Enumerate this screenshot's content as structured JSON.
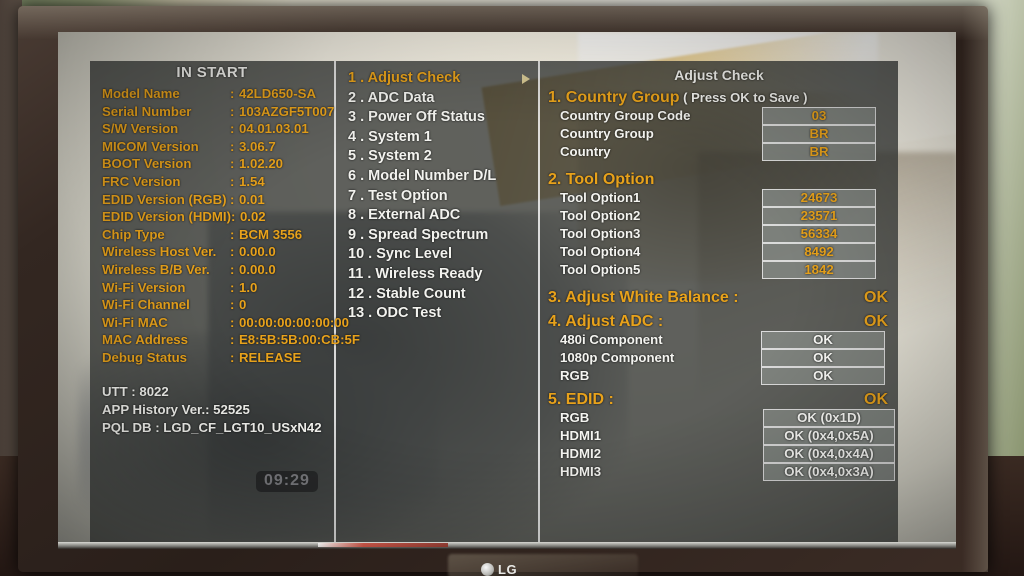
{
  "device": {
    "brand": "LG",
    "clock": "09:29"
  },
  "left_panel": {
    "title": "IN START",
    "info": [
      {
        "key": "Model Name",
        "sep": ":",
        "value": "42LD650-SA"
      },
      {
        "key": "Serial Number",
        "sep": ":",
        "value": "103AZGF5T007"
      },
      {
        "key": "S/W Version",
        "sep": ":",
        "value": "04.01.03.01"
      },
      {
        "key": "MICOM Version",
        "sep": ":",
        "value": "3.06.7"
      },
      {
        "key": "BOOT Version",
        "sep": ":",
        "value": "1.02.20"
      },
      {
        "key": "FRC Version",
        "sep": ":",
        "value": "1.54"
      },
      {
        "key": "EDID Version (RGB)",
        "sep": ":",
        "value": "0.01"
      },
      {
        "key": "EDID Version (HDMI)",
        "sep": ":",
        "value": "0.02"
      },
      {
        "key": "Chip Type",
        "sep": ":",
        "value": "BCM 3556"
      },
      {
        "key": "Wireless Host Ver.",
        "sep": ":",
        "value": "0.00.0"
      },
      {
        "key": "Wireless B/B Ver.",
        "sep": ":",
        "value": "0.00.0"
      },
      {
        "key": "Wi-Fi Version",
        "sep": ":",
        "value": "1.0"
      },
      {
        "key": "Wi-Fi Channel",
        "sep": ":",
        "value": "0"
      },
      {
        "key": "Wi-Fi MAC",
        "sep": ":",
        "value": "00:00:00:00:00:00"
      },
      {
        "key": "MAC Address",
        "sep": ":",
        "value": "E8:5B:5B:00:CB:5F"
      },
      {
        "key": "Debug Status",
        "sep": ":",
        "value": "RELEASE"
      }
    ],
    "footer": [
      "UTT : 8022",
      "APP History Ver.: 52525",
      "PQL DB : LGD_CF_LGT10_USxN42"
    ]
  },
  "menu": {
    "items": [
      {
        "num": "1 .",
        "label": "Adjust Check",
        "selected": true,
        "has_arrow": true
      },
      {
        "num": "2 .",
        "label": "ADC Data",
        "selected": false,
        "has_arrow": false
      },
      {
        "num": "3 .",
        "label": "Power Off Status",
        "selected": false,
        "has_arrow": false
      },
      {
        "num": "4 .",
        "label": "System 1",
        "selected": false,
        "has_arrow": false
      },
      {
        "num": "5 .",
        "label": "System 2",
        "selected": false,
        "has_arrow": false
      },
      {
        "num": "6 .",
        "label": "Model Number D/L",
        "selected": false,
        "has_arrow": false
      },
      {
        "num": "7 .",
        "label": "Test Option",
        "selected": false,
        "has_arrow": false
      },
      {
        "num": "8 .",
        "label": "External ADC",
        "selected": false,
        "has_arrow": false
      },
      {
        "num": "9 .",
        "label": "Spread Spectrum",
        "selected": false,
        "has_arrow": false
      },
      {
        "num": "10 .",
        "label": "Sync Level",
        "selected": false,
        "has_arrow": false
      },
      {
        "num": "11 .",
        "label": "Wireless Ready",
        "selected": false,
        "has_arrow": false
      },
      {
        "num": "12 .",
        "label": "Stable Count",
        "selected": false,
        "has_arrow": false
      },
      {
        "num": "13 .",
        "label": "ODC Test",
        "selected": false,
        "has_arrow": false
      }
    ]
  },
  "detail": {
    "title": "Adjust Check",
    "sections": [
      {
        "heading": "1. Country Group",
        "note": "( Press OK to Save )",
        "rows": [
          {
            "label": "Country Group Code",
            "value": "03",
            "style": "amber",
            "box": "narrow"
          },
          {
            "label": "Country Group",
            "value": "BR",
            "style": "amber",
            "box": "narrow"
          },
          {
            "label": "Country",
            "value": "BR",
            "style": "amber",
            "box": "narrow"
          }
        ]
      },
      {
        "heading": "2. Tool Option",
        "note": "",
        "rows": [
          {
            "label": "Tool Option1",
            "value": "24673",
            "style": "amber",
            "box": "narrow"
          },
          {
            "label": "Tool Option2",
            "value": "23571",
            "style": "amber",
            "box": "narrow"
          },
          {
            "label": "Tool Option3",
            "value": "56334",
            "style": "amber",
            "box": "narrow"
          },
          {
            "label": "Tool Option4",
            "value": "8492",
            "style": "amber",
            "box": "narrow"
          },
          {
            "label": "Tool Option5",
            "value": "1842",
            "style": "amber",
            "box": "narrow"
          }
        ]
      },
      {
        "heading": "3. Adjust White Balance :",
        "note": "",
        "status": "OK",
        "rows": []
      },
      {
        "heading": "4. Adjust ADC :",
        "note": "",
        "status": "OK",
        "rows": [
          {
            "label": "480i Component",
            "value": "OK",
            "style": "white",
            "box": "mid"
          },
          {
            "label": "1080p Component",
            "value": "OK",
            "style": "white",
            "box": "mid"
          },
          {
            "label": "RGB",
            "value": "OK",
            "style": "white",
            "box": "mid"
          }
        ]
      },
      {
        "heading": "5. EDID :",
        "note": "",
        "status": "OK",
        "rows": [
          {
            "label": "RGB",
            "value": "OK (0x1D)",
            "style": "white",
            "box": "wide"
          },
          {
            "label": "HDMI1",
            "value": "OK (0x4,0x5A)",
            "style": "white",
            "box": "wide"
          },
          {
            "label": "HDMI2",
            "value": "OK (0x4,0x4A)",
            "style": "white",
            "box": "wide"
          },
          {
            "label": "HDMI3",
            "value": "OK (0x4,0x3A)",
            "style": "white",
            "box": "wide"
          }
        ]
      }
    ]
  },
  "colors": {
    "amber": "#e8a21b",
    "white": "#f4f4f0",
    "osd_bg": "rgba(58,60,58,.80)",
    "value_box": "rgba(132,136,132,.85)"
  }
}
